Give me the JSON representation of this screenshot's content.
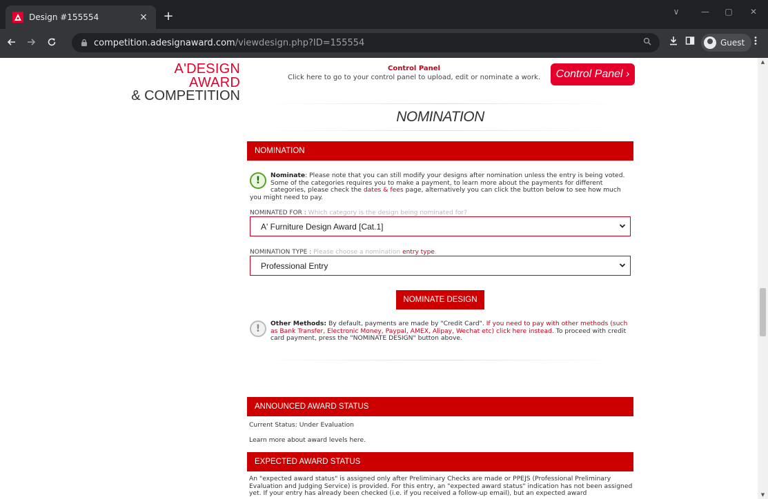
{
  "browser": {
    "tab_title": "Design #155554",
    "tab_close": "×",
    "new_tab": "+",
    "url_host": "competition.adesignaward.com",
    "url_path": "/viewdesign.php?ID=155554",
    "profile_label": "Guest",
    "window_controls": [
      "∨",
      "—",
      "▢",
      "✕"
    ]
  },
  "header": {
    "logo_line1": "A'DESIGN AWARD",
    "logo_line2": "& COMPETITION",
    "control_panel_title": "Control Panel",
    "control_panel_desc": "Click here to go to your control panel to upload, edit or nominate a work.",
    "control_panel_button": "Control Panel ›"
  },
  "page": {
    "heading": "NOMINATION"
  },
  "nomination": {
    "bar_title": "NOMINATION",
    "notice": {
      "bold": "Nominate",
      "text_before_link": ": Please note that you can still modify your designs after nomination unless the entry is being voted. Some of the categories requires you to make a payment, to learn more about the payments for different categories, please check the ",
      "link": "dates & fees",
      "text_after_link": " page, alternatively you can click the button below to see how much you might need to pay."
    },
    "nominated_for": {
      "label": "NOMINATED FOR : ",
      "hint": "Which category is the design being nominated for?",
      "value": "A' Furniture Design Award [Cat.1]"
    },
    "nomination_type": {
      "label": "NOMINATION TYPE : ",
      "hint": "Please choose a nomination ",
      "hint_link": "entry type",
      "hint_end": ".",
      "value": "Professional Entry"
    },
    "submit_button": "NOMINATE DESIGN",
    "other_methods": {
      "bold": "Other Methods:",
      "text_before_link": " By default, payments are made by \"Credit Card\". ",
      "link": "If you need to pay with other methods (such as Bank Transfer, Electronic Money, Paypal, AMEX, Alipay, Wechat etc) click here instead.",
      "text_after_link": " To proceed with credit card payment, press the \"NOMINATE DESIGN\" button above."
    }
  },
  "announced": {
    "bar_title": "ANNOUNCED AWARD STATUS",
    "status": "Current Status: Under Evaluation",
    "link": "Learn more about award levels here."
  },
  "expected": {
    "bar_title": "EXPECTED AWARD STATUS",
    "text": "An \"expected award status\" is assigned only after Preliminary Checks are made or PPEJS (Professional Preliminary Evaluation and Judging Service) is provided. For this entry, an \"expected award status\" indication has not been assigned yet. If your entry has already been checked (i.e. if you received a follow-up email), but an expected award"
  },
  "colors": {
    "brand_red": "#cc0000",
    "accent_red": "#e4002b",
    "success_green": "#5aa02c"
  },
  "icons": {
    "favicon": "adesign-logo-icon",
    "back": "arrow-left-icon",
    "forward": "arrow-right-icon",
    "reload": "reload-icon",
    "lock": "lock-icon",
    "zoom": "zoom-icon",
    "download": "download-icon",
    "sidepanel": "side-panel-icon",
    "menu": "kebab-menu-icon",
    "nominate_notice": "exclamation-circle-icon",
    "other_methods_notice": "exclamation-circle-icon"
  }
}
